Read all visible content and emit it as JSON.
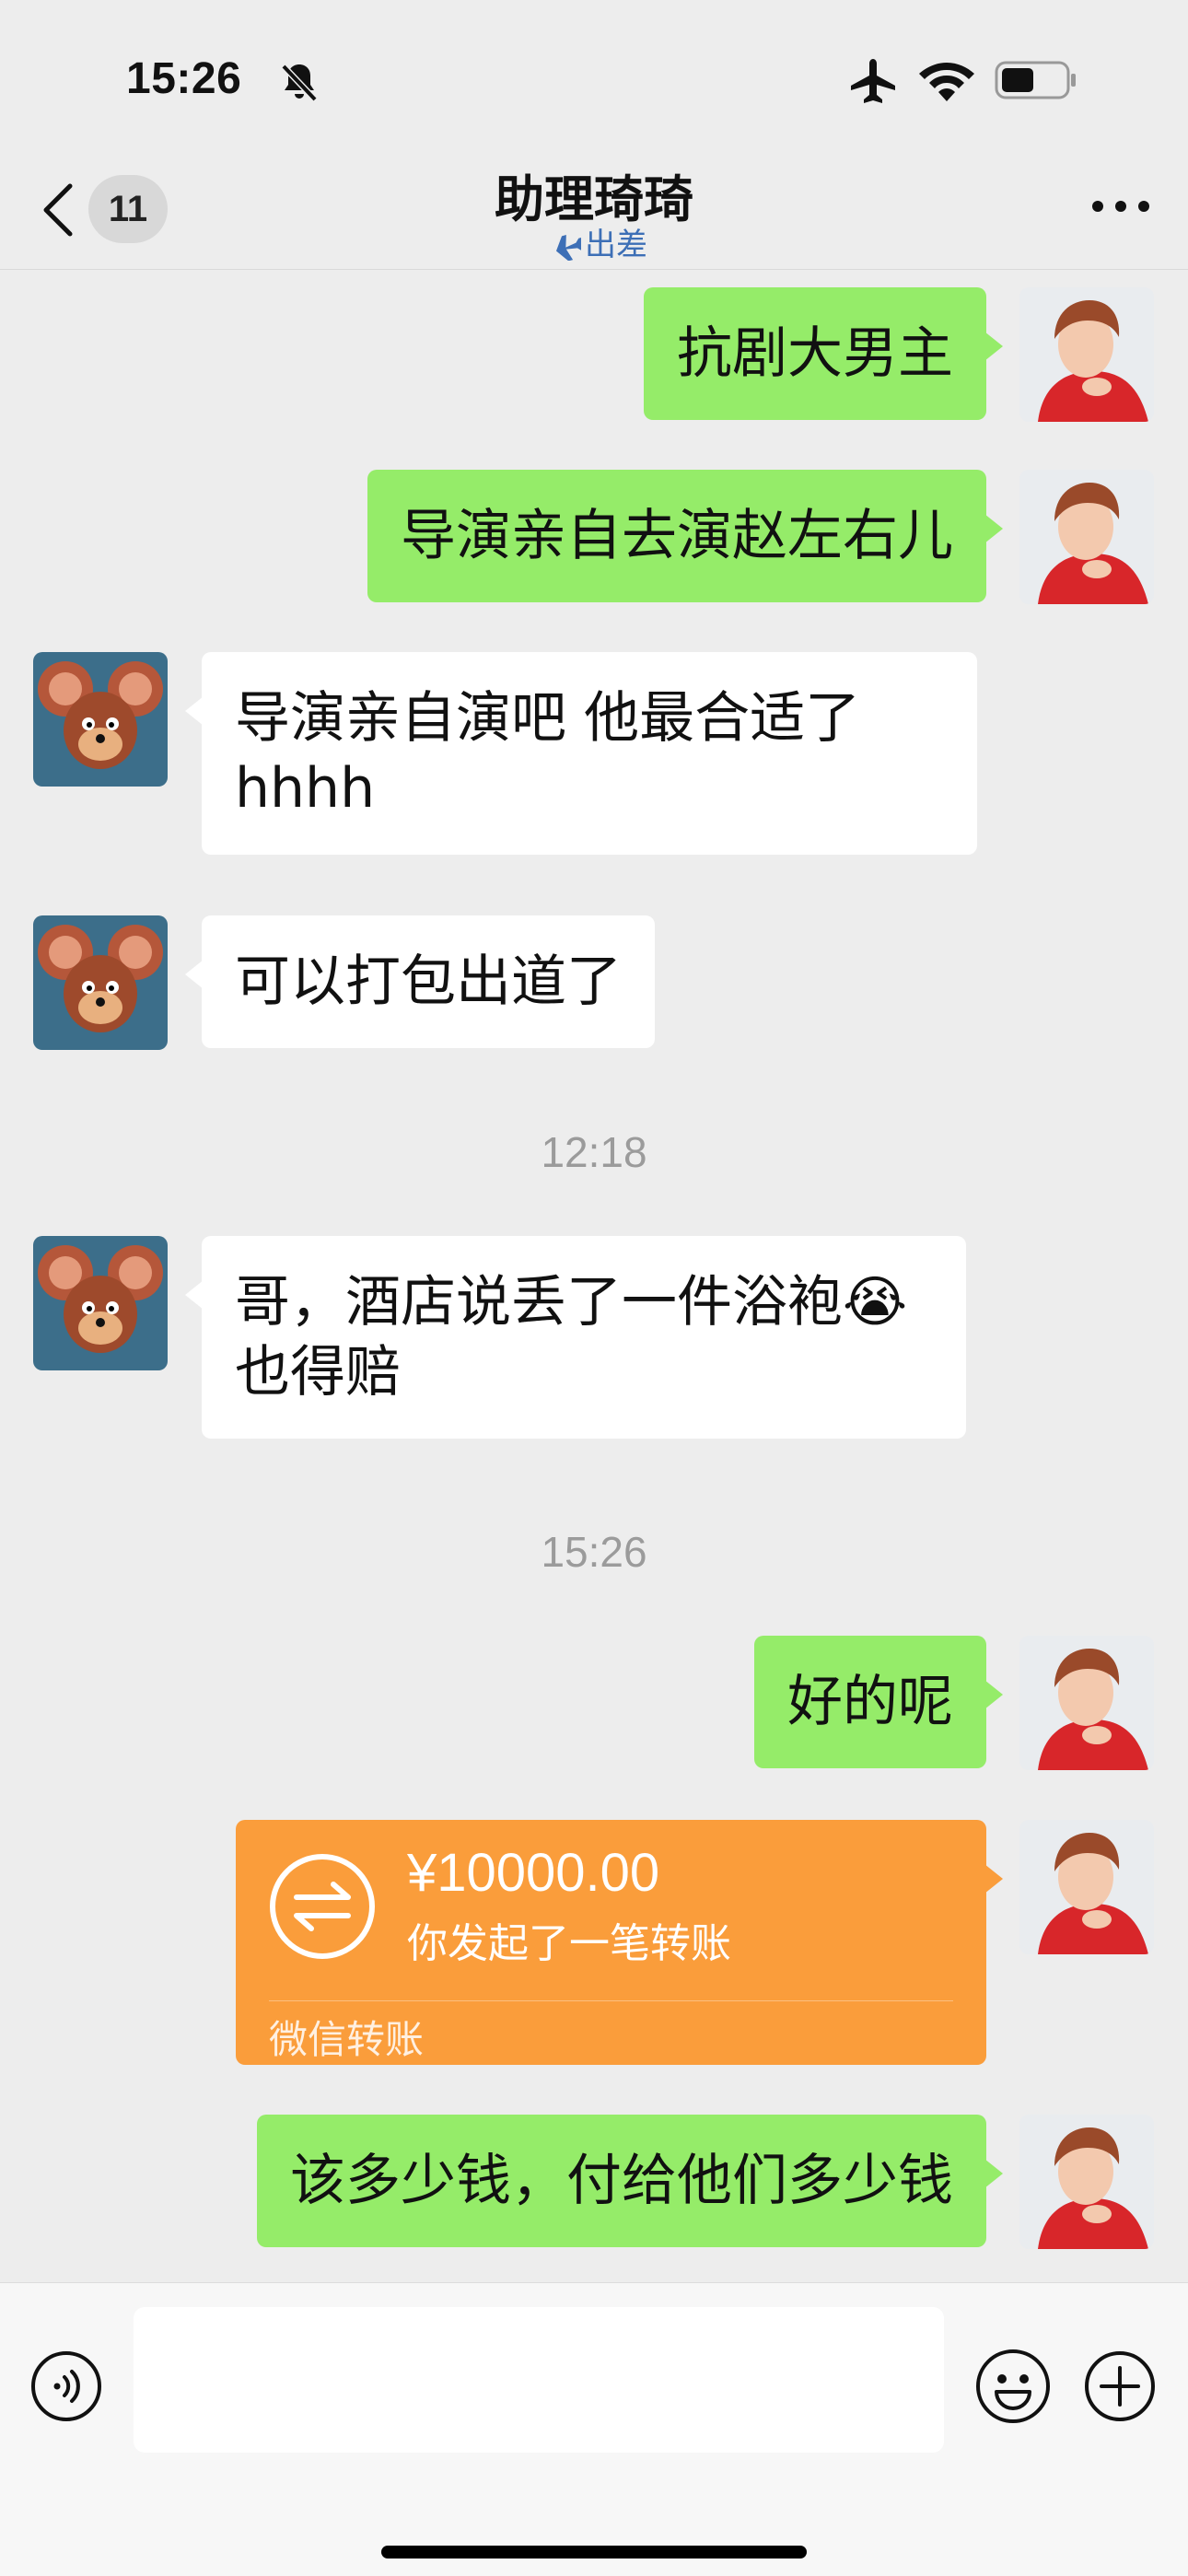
{
  "status_bar": {
    "time": "15:26",
    "icons": [
      "bell-slash-icon",
      "airplane-icon",
      "wifi-icon",
      "battery-icon"
    ]
  },
  "nav": {
    "back_badge": "11",
    "title": "助理琦琦",
    "subtitle": "出差",
    "icons": [
      "chevron-left-icon",
      "plane-status-icon",
      "more-icon"
    ]
  },
  "messages": [
    {
      "from": "me",
      "text": "抗剧大男主"
    },
    {
      "from": "me",
      "text": "导演亲自去演赵左右儿"
    },
    {
      "from": "them",
      "text": "导演亲自演吧 他最合适了hhhh"
    },
    {
      "from": "them",
      "text": "可以打包出道了"
    },
    {
      "timestamp": "12:18"
    },
    {
      "from": "them",
      "text": "哥，酒店说丢了一件浴袍😭也得赔"
    },
    {
      "timestamp": "15:26"
    },
    {
      "from": "me",
      "text": "好的呢"
    },
    {
      "from": "me",
      "type": "transfer",
      "amount": "¥10000.00",
      "desc": "你发起了一笔转账",
      "footer": "微信转账"
    },
    {
      "from": "me",
      "text": "该多少钱，付给他们多少钱"
    }
  ],
  "input_bar": {
    "icons": [
      "voice-icon",
      "emoji-icon",
      "plus-icon"
    ],
    "value": ""
  },
  "colors": {
    "background": "#ededed",
    "my_bubble": "#95ec69",
    "their_bubble": "#ffffff",
    "transfer": "#fa9d3b"
  }
}
